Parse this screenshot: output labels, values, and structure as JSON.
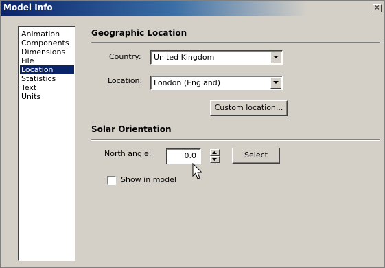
{
  "window": {
    "title": "Model Info",
    "close_glyph": "×"
  },
  "sidebar": {
    "items": [
      {
        "label": "Animation"
      },
      {
        "label": "Components"
      },
      {
        "label": "Dimensions"
      },
      {
        "label": "File"
      },
      {
        "label": "Location",
        "selected": true
      },
      {
        "label": "Statistics"
      },
      {
        "label": "Text"
      },
      {
        "label": "Units"
      }
    ]
  },
  "geographic": {
    "title": "Geographic Location",
    "country_label": "Country:",
    "country_value": "United Kingdom",
    "location_label": "Location:",
    "location_value": "London (England)",
    "custom_button": "Custom location..."
  },
  "solar": {
    "title": "Solar Orientation",
    "north_label": "North angle:",
    "north_value": "0.0",
    "select_button": "Select",
    "show_label": "Show in model",
    "show_checked": false
  },
  "colors": {
    "selection": "#0a246a",
    "titlebar_start": "#0a246a",
    "face": "#d4d0c8"
  },
  "icons": [
    "close-icon",
    "dropdown-arrow-icon",
    "spin-up-icon",
    "spin-down-icon",
    "mouse-cursor-icon"
  ]
}
